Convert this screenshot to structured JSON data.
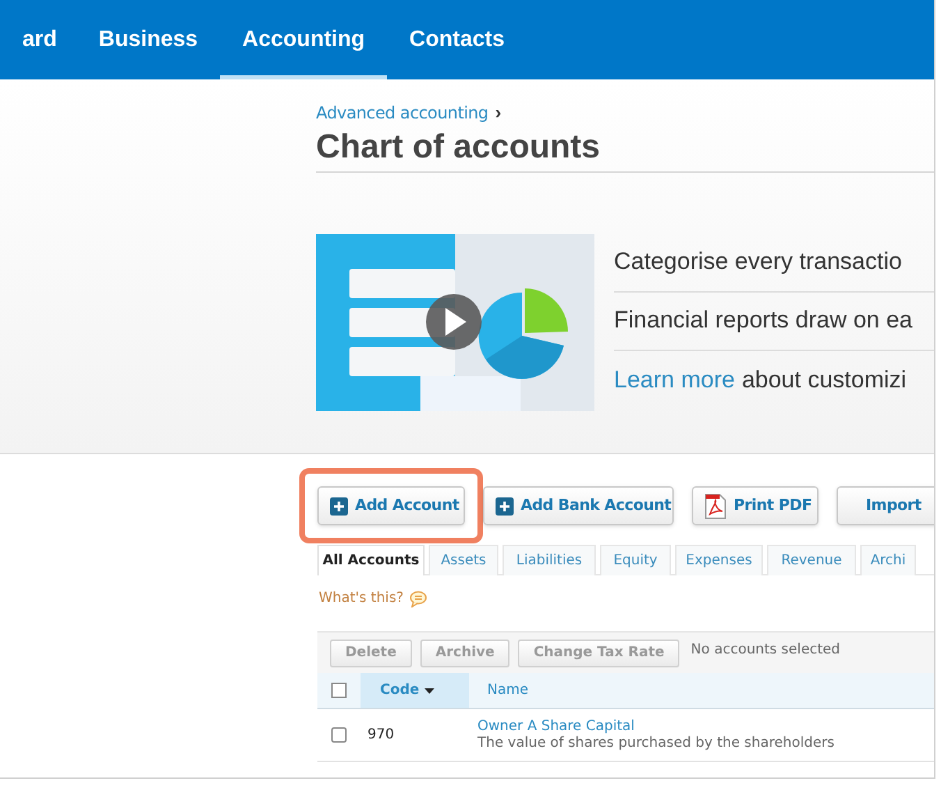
{
  "nav": [
    {
      "label": "ard",
      "selected": false
    },
    {
      "label": "Business",
      "selected": false
    },
    {
      "label": "Accounting",
      "selected": true
    },
    {
      "label": "Contacts",
      "selected": false
    }
  ],
  "breadcrumb": "Advanced accounting",
  "breadcrumb_separator": "›",
  "title": "Chart of accounts",
  "intro": {
    "video": {
      "kind": "picture"
    },
    "lines": [
      "Categorise every transactio",
      "Financial reports draw on ea"
    ],
    "learn_more": {
      "link": "Learn more",
      "text": "about customizi"
    }
  },
  "actions": [
    {
      "label": "Add Account",
      "kind": "add",
      "highlighted": true
    },
    {
      "label": "Add Bank Account",
      "kind": "add",
      "highlighted": false
    },
    {
      "label": "Print PDF",
      "kind": "pdf",
      "highlighted": false
    },
    {
      "label": "Import",
      "kind": "plain",
      "highlighted": false
    }
  ],
  "tabs": [
    {
      "label": "All Accounts",
      "selected": true
    },
    {
      "label": "Assets",
      "selected": false
    },
    {
      "label": "Liabilities",
      "selected": false
    },
    {
      "label": "Equity",
      "selected": false
    },
    {
      "label": "Expenses",
      "selected": false
    },
    {
      "label": "Revenue",
      "selected": false
    },
    {
      "label": "Archi",
      "selected": false
    }
  ],
  "whats_this": "What's this?",
  "bulk_actions": [
    "Delete",
    "Archive",
    "Change Tax Rate"
  ],
  "selection_status": "No accounts selected",
  "table": {
    "columns": [
      {
        "label": "Code",
        "sorted": true
      },
      {
        "label": "Name",
        "sorted": false
      }
    ],
    "select_all_checked": false,
    "rows": [
      {
        "checked": false,
        "code": "970",
        "name": "Owner A Share Capital",
        "description": "The value of shares purchased by the shareholders"
      }
    ]
  }
}
